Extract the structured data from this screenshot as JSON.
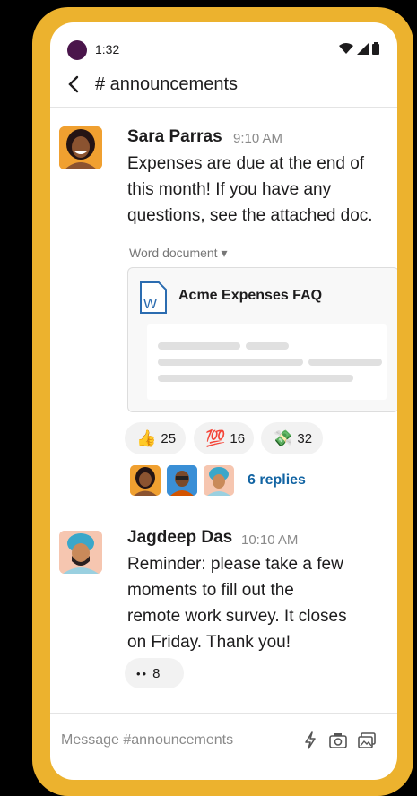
{
  "status": {
    "time": "1:32"
  },
  "channel": {
    "title": "# announcements"
  },
  "messages": [
    {
      "author": "Sara Parras",
      "time": "9:10 AM",
      "lines": [
        "Expenses are due at the end of",
        "this month! If you have any",
        "questions, see the attached doc."
      ],
      "attachment": {
        "type_label": "Word document ▾",
        "icon_letter": "W",
        "title": "Acme Expenses FAQ"
      },
      "reactions": [
        {
          "emoji": "👍",
          "count": "25"
        },
        {
          "emoji": "💯",
          "count": "16"
        },
        {
          "emoji": "💸",
          "count": "32"
        }
      ],
      "replies": "6 replies"
    },
    {
      "author": "Jagdeep Das",
      "time": "10:10 AM",
      "lines": [
        "Reminder: please take a few",
        "moments to fill out the",
        "remote work survey. It closes",
        "on Friday. Thank you!"
      ],
      "reactions": [
        {
          "emoji": "••",
          "count": "8"
        }
      ]
    }
  ],
  "composer": {
    "placeholder": "Message #announcements"
  },
  "colors": {
    "frame": "#ecb22e",
    "aubergine": "#4a154b",
    "link": "#1264a3"
  }
}
